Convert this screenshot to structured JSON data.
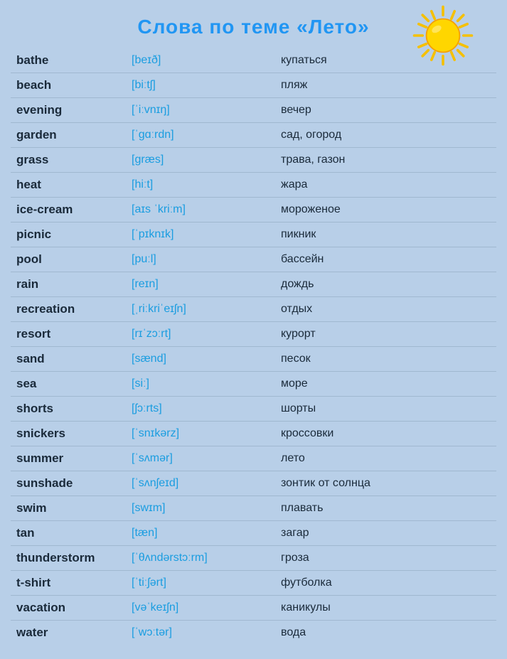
{
  "title": "Слова по теме «Лето»",
  "words": [
    {
      "word": "bathe",
      "transcription": "[beɪð]",
      "translation": "купаться"
    },
    {
      "word": "beach",
      "transcription": "[biːtʃ]",
      "translation": "пляж"
    },
    {
      "word": "evening",
      "transcription": "[ˈiːvnɪŋ]",
      "translation": "вечер"
    },
    {
      "word": "garden",
      "transcription": "[ˈɡɑːrdn]",
      "translation": "сад, огород"
    },
    {
      "word": "grass",
      "transcription": "[græs]",
      "translation": "трава, газон"
    },
    {
      "word": "heat",
      "transcription": "[hiːt]",
      "translation": "жара"
    },
    {
      "word": "ice-cream",
      "transcription": "[aɪs ˈkriːm]",
      "translation": "мороженое"
    },
    {
      "word": "picnic",
      "transcription": "[ˈpɪknɪk]",
      "translation": "пикник"
    },
    {
      "word": "pool",
      "transcription": "[puːl]",
      "translation": "бассейн"
    },
    {
      "word": "rain",
      "transcription": "[reɪn]",
      "translation": "дождь"
    },
    {
      "word": "recreation",
      "transcription": "[ˌriːkriˈeɪʃn]",
      "translation": "отдых"
    },
    {
      "word": "resort",
      "transcription": "[rɪˈzɔːrt]",
      "translation": "курорт"
    },
    {
      "word": "sand",
      "transcription": "[sænd]",
      "translation": "песок"
    },
    {
      "word": "sea",
      "transcription": "[siː]",
      "translation": "море"
    },
    {
      "word": "shorts",
      "transcription": "[ʃɔːrts]",
      "translation": "шорты"
    },
    {
      "word": "snickers",
      "transcription": "[ˈsnɪkərz]",
      "translation": "кроссовки"
    },
    {
      "word": "summer",
      "transcription": "[ˈsʌmər]",
      "translation": "лето"
    },
    {
      "word": "sunshade",
      "transcription": "[ˈsʌnʃeɪd]",
      "translation": "зонтик от солнца"
    },
    {
      "word": "swim",
      "transcription": "[swɪm]",
      "translation": "плавать"
    },
    {
      "word": "tan",
      "transcription": "[tæn]",
      "translation": "загар"
    },
    {
      "word": "thunderstorm",
      "transcription": "[ˈθʌndərstɔːrm]",
      "translation": "гроза"
    },
    {
      "word": "t-shirt",
      "transcription": "[ˈtiːʃərt]",
      "translation": "футболка"
    },
    {
      "word": "vacation",
      "transcription": "[vəˈkeɪʃn]",
      "translation": "каникулы"
    },
    {
      "word": "water",
      "transcription": "[ˈwɔːtər]",
      "translation": "вода"
    }
  ],
  "sun": {
    "label": "sun-decoration"
  }
}
